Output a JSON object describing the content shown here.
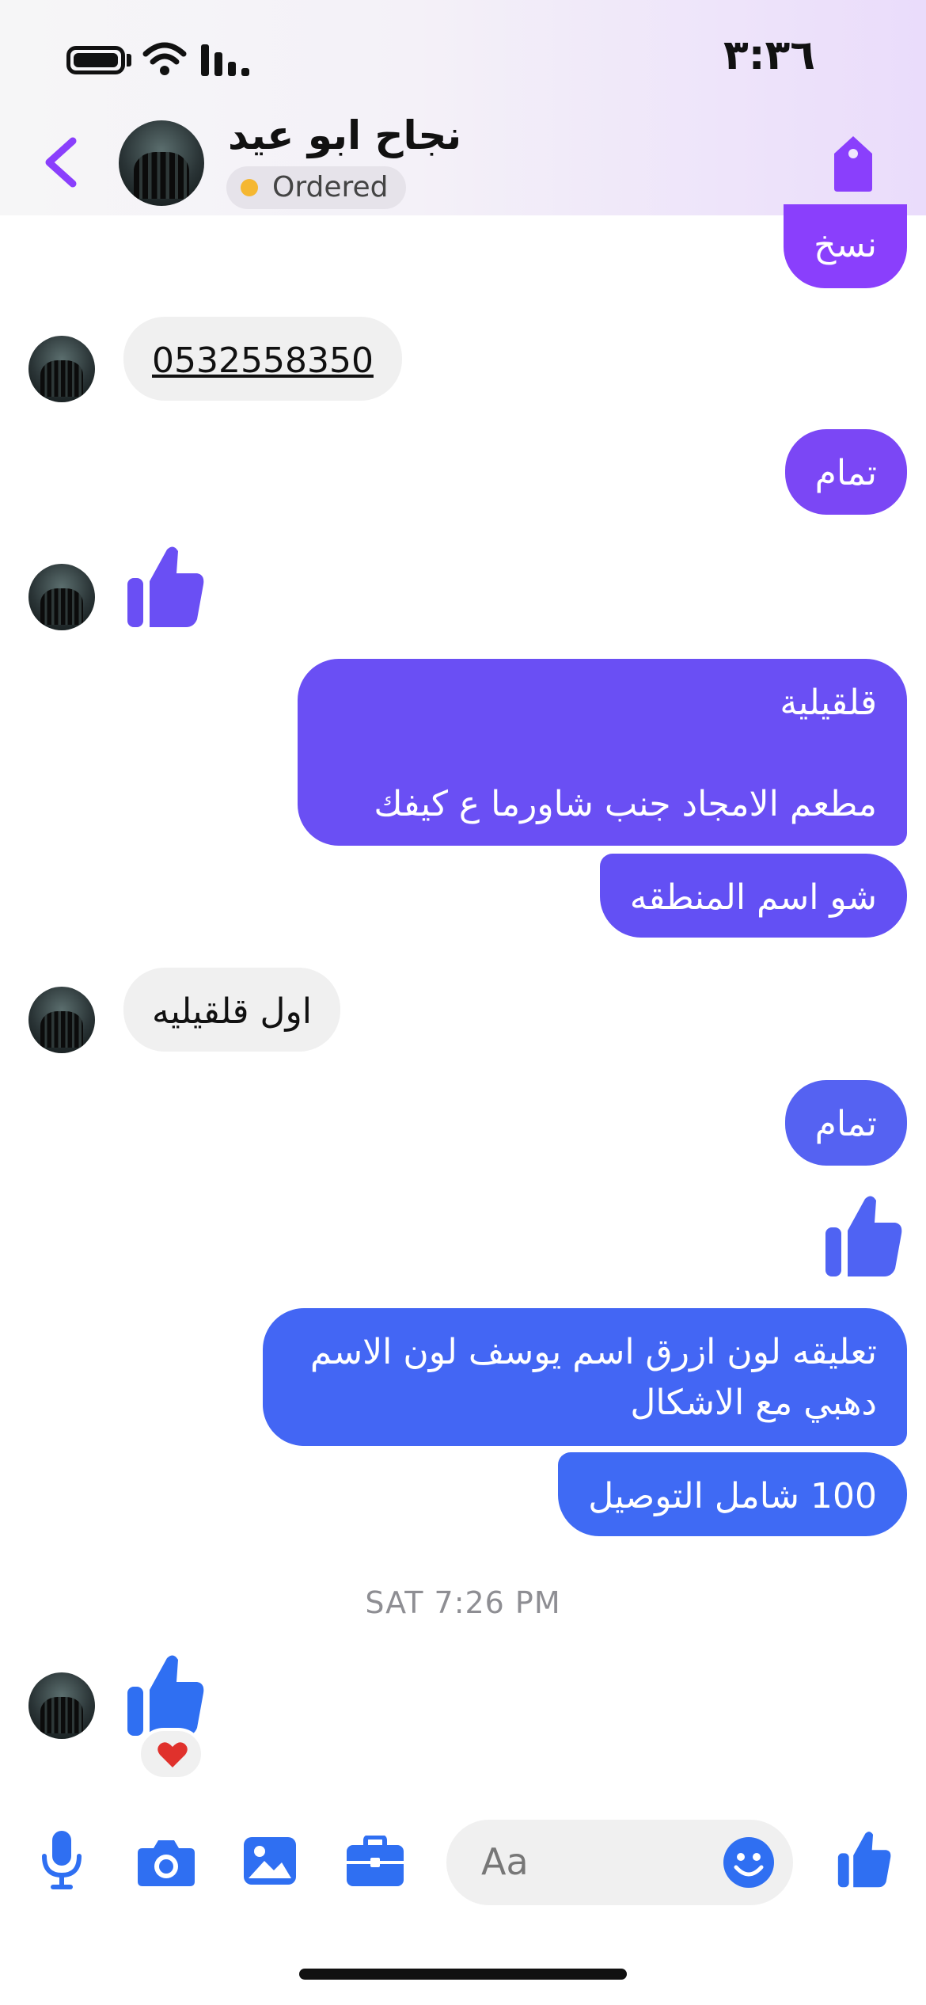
{
  "status_bar": {
    "time": "٣:٣٦"
  },
  "header": {
    "contact_name": "نجاح ابو عيد",
    "status_label": "Ordered"
  },
  "messages": {
    "m1": "نسخ",
    "m2": "0532558350",
    "m3": "تمام",
    "m4_line1": "قلقيلية",
    "m4_line2": "مطعم الامجاد جنب شاورما ع كيفك",
    "m5": "شو اسم المنطقه",
    "m6": "اول قلقيليه",
    "m7": "تمام",
    "m8": "تعليقه لون ازرق اسم يوسف لون الاسم دهبي مع الاشكال",
    "m9": "100 شامل التوصيل"
  },
  "timestamp": "SAT 7:26 PM",
  "composer": {
    "placeholder": "Aa"
  },
  "colors": {
    "accent_purple": "#8a3ffc",
    "bubble_violet": "#6a4ff4",
    "bubble_indigo": "#5562f2",
    "bubble_blue": "#4366f4",
    "composer_blue": "#2f6ff2"
  }
}
